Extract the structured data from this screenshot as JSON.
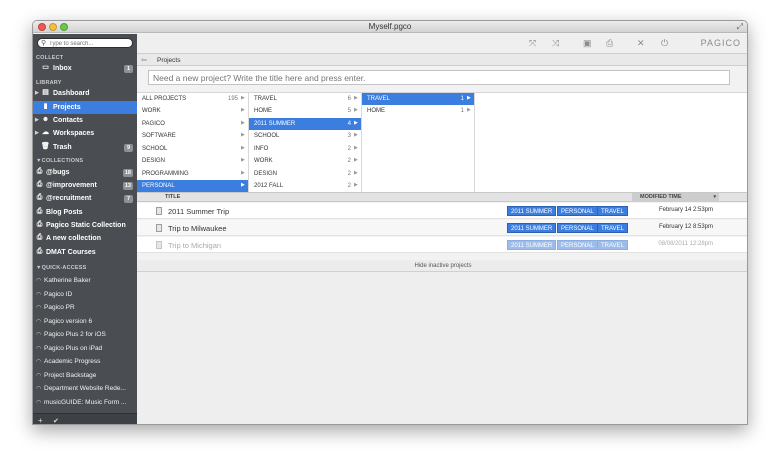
{
  "window": {
    "title": "Myself.pgco"
  },
  "sidebar": {
    "search_placeholder": "Type to search...",
    "collect_header": "COLLECT",
    "inbox": {
      "label": "Inbox",
      "badge": "1"
    },
    "library_header": "LIBRARY",
    "library": [
      {
        "label": "Dashboard"
      },
      {
        "label": "Projects"
      },
      {
        "label": "Contacts"
      },
      {
        "label": "Workspaces"
      },
      {
        "label": "Trash",
        "badge": "9"
      }
    ],
    "collections_header": "COLLECTIONS",
    "collections": [
      {
        "label": "@bugs",
        "badge": "18"
      },
      {
        "label": "@improvement",
        "badge": "13"
      },
      {
        "label": "@recruitment",
        "badge": "7"
      },
      {
        "label": "Blog Posts"
      },
      {
        "label": "Pagico Static Collection"
      },
      {
        "label": "A new collection"
      },
      {
        "label": "DMAT Courses"
      }
    ],
    "quick_header": "QUICK-ACCESS",
    "quick": [
      "Katherine Baker",
      "Pagico ID",
      "Pagico PR",
      "Pagico version 6",
      "Pagico Plus 2 for iOS",
      "Pagico Plus on iPad",
      "Academic Progress",
      "Project Backstage",
      "Department Website Rede...",
      "musicGUIDE: Music Form ..."
    ],
    "footer": {
      "add": "+",
      "check": "✔"
    }
  },
  "toolbar": {
    "brand": "PAGICO"
  },
  "breadcrumb": {
    "current": "Projects"
  },
  "new_project_placeholder": "Need a new project? Write the title here and press enter.",
  "browser": {
    "col1": [
      {
        "name": "ALL PROJECTS",
        "count": "195"
      },
      {
        "name": "WORK",
        "count": ""
      },
      {
        "name": "PAGICO",
        "count": ""
      },
      {
        "name": "SOFTWARE",
        "count": ""
      },
      {
        "name": "SCHOOL",
        "count": ""
      },
      {
        "name": "DESIGN",
        "count": ""
      },
      {
        "name": "PROGRAMMING",
        "count": ""
      },
      {
        "name": "PERSONAL",
        "count": ""
      }
    ],
    "col2": [
      {
        "name": "TRAVEL",
        "count": "6"
      },
      {
        "name": "HOME",
        "count": "5"
      },
      {
        "name": "2011 SUMMER",
        "count": "4"
      },
      {
        "name": "SCHOOL",
        "count": "3"
      },
      {
        "name": "INFO",
        "count": "2"
      },
      {
        "name": "WORK",
        "count": "2"
      },
      {
        "name": "DESIGN",
        "count": "2"
      },
      {
        "name": "2012 FALL",
        "count": "2"
      }
    ],
    "col3": [
      {
        "name": "TRAVEL",
        "count": "1"
      },
      {
        "name": "HOME",
        "count": "1"
      }
    ]
  },
  "table": {
    "title_header": "TITLE",
    "time_header": "MODIFIED TIME",
    "rows": [
      {
        "title": "2011 Summer Trip",
        "tags": [
          "2011 SUMMER",
          "PERSONAL",
          "TRAVEL"
        ],
        "time": "February 14 2:53pm",
        "inactive": false
      },
      {
        "title": "Trip to Milwaukee",
        "tags": [
          "2011 SUMMER",
          "PERSONAL",
          "TRAVEL"
        ],
        "time": "February 12 8:53pm",
        "inactive": false
      },
      {
        "title": "Trip to Michigan",
        "tags": [
          "2011 SUMMER",
          "PERSONAL",
          "TRAVEL"
        ],
        "time": "08/08/2011 12:28pm",
        "inactive": true
      }
    ],
    "hide_label": "Hide inactive projects"
  },
  "colors": {
    "accent": "#3c7ee0",
    "sidebar_bg": "#4a4d52"
  }
}
